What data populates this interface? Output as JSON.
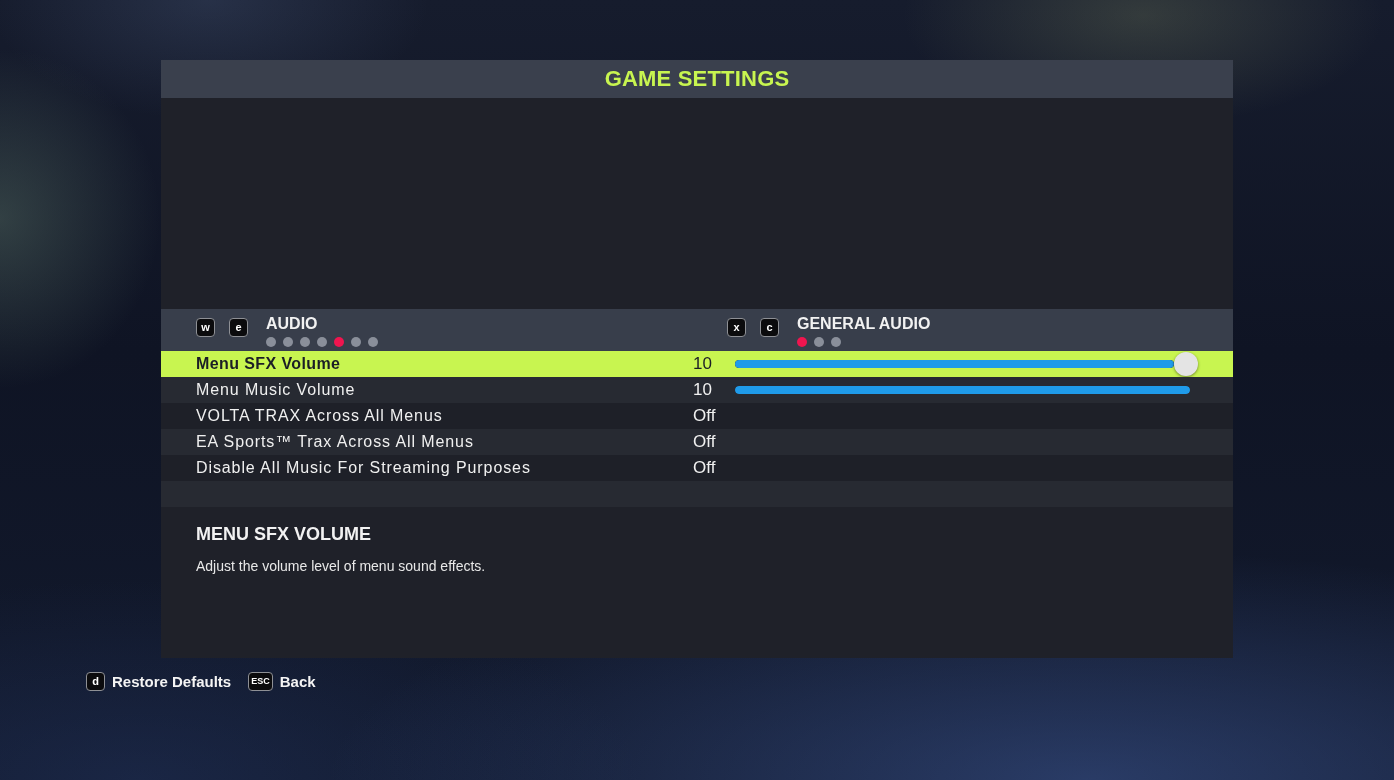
{
  "title": "GAME SETTINGS",
  "categories": [
    {
      "keys": [
        "w",
        "e"
      ],
      "label": "AUDIO",
      "pages": [
        {
          "selected": false
        },
        {
          "selected": false
        },
        {
          "selected": false
        },
        {
          "selected": false
        },
        {
          "selected": true
        },
        {
          "selected": false
        },
        {
          "selected": false
        }
      ]
    },
    {
      "keys": [
        "x",
        "c"
      ],
      "label": "GENERAL AUDIO",
      "pages": [
        {
          "selected": true
        },
        {
          "selected": false
        },
        {
          "selected": false
        }
      ]
    }
  ],
  "settings": [
    {
      "kind": "slider",
      "label": "Menu SFX Volume",
      "value": "10",
      "level": 1,
      "selected": true
    },
    {
      "kind": "slider",
      "label": "Menu Music Volume",
      "value": "10",
      "level": 1,
      "selected": false
    },
    {
      "kind": "toggle",
      "label": "VOLTA TRAX Across All Menus",
      "value": "Off",
      "selected": false
    },
    {
      "kind": "toggle",
      "label": "EA Sports™ Trax Across All Menus",
      "value": "Off",
      "selected": false
    },
    {
      "kind": "toggle",
      "label": "Disable All Music For Streaming Purposes",
      "value": "Off",
      "selected": false
    }
  ],
  "description": {
    "heading": "MENU SFX VOLUME",
    "text": "Adjust the volume level of menu sound effects."
  },
  "footer_actions": [
    {
      "key": "d",
      "label": "Restore Defaults"
    },
    {
      "key": "ESC",
      "label": "Back"
    }
  ]
}
